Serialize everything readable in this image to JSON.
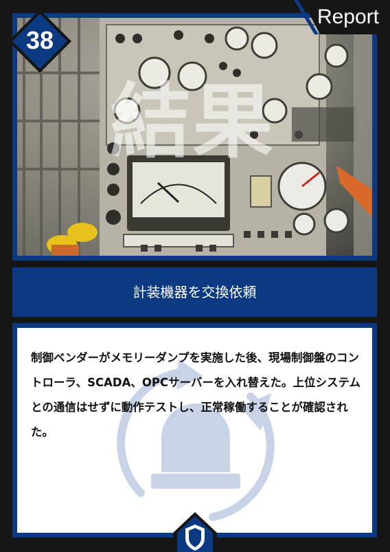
{
  "card": {
    "number": "38",
    "category_label": "Report",
    "photo_overlay_text": "結果",
    "title": "計装機器を交換依頼",
    "description": "制御ベンダーがメモリーダンプを実施した後、現場制御盤のコントローラ、SCADA、OPCサーバーを入れ替えた。上位システムとの通信はせずに動作テストし、正常稼働することが確認された。"
  },
  "icons": {
    "watermark": "alarm-light-refresh-icon",
    "footer": "shield-icon"
  },
  "colors": {
    "frame_blue": "#0b3a82",
    "background": "#161616",
    "watermark": "#c9d3e8"
  }
}
